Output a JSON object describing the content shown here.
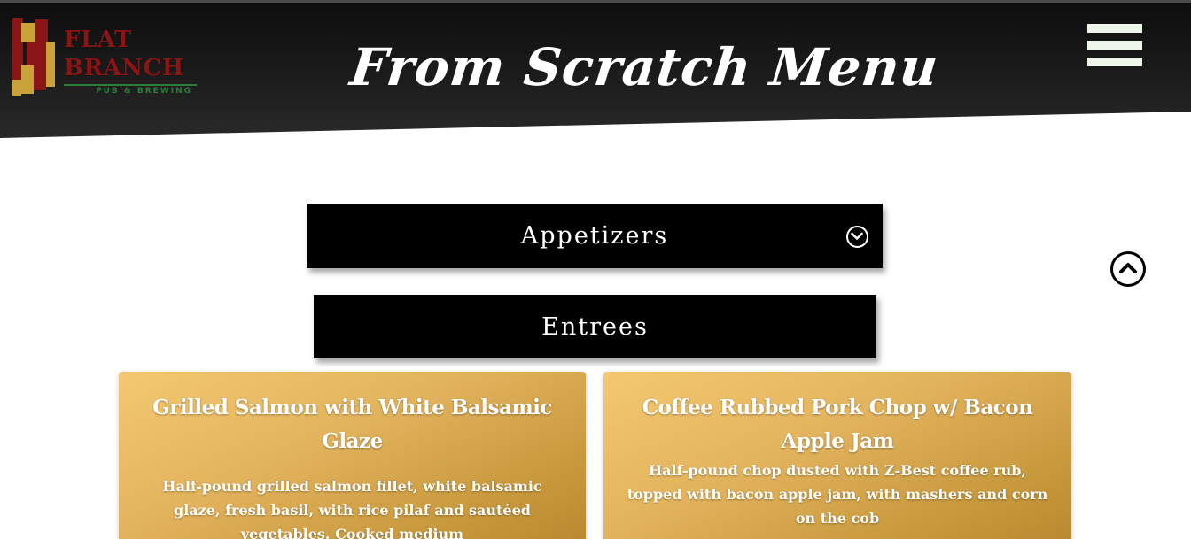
{
  "header": {
    "title": "From Scratch Menu",
    "logo": {
      "line1": "FLAT",
      "line2": "BRANCH",
      "sub": "PUB & BREWING"
    },
    "menu_icon": "hamburger-menu-icon"
  },
  "categories": [
    {
      "label": "Appetizers",
      "icon": "chevron-down-circle-icon"
    },
    {
      "label": "Entrees"
    }
  ],
  "scroll_top_icon": "chevron-up-circle-icon",
  "items": [
    {
      "title": "Grilled Salmon with White Balsamic Glaze",
      "description": "Half-pound grilled salmon fillet, white balsamic glaze, fresh basil, with rice pilaf and sautéed vegetables. Cooked medium"
    },
    {
      "title": "Coffee Rubbed Pork Chop w/ Bacon Apple Jam",
      "description": "Half-pound chop dusted with Z-Best coffee rub, topped with bacon apple jam, with mashers and corn on the cob"
    }
  ],
  "colors": {
    "header_bg": "#1a1a1a",
    "card_gold": "#e3b45e",
    "bar_bg": "#000000",
    "logo_red": "#8a1515",
    "logo_green": "#2e7d3a"
  }
}
